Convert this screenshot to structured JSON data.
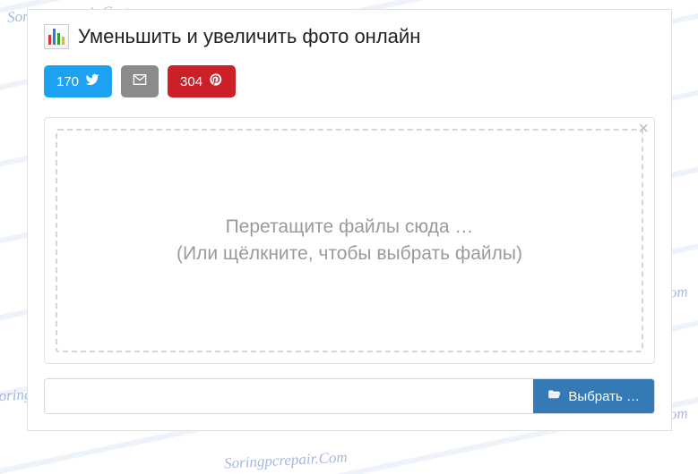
{
  "page": {
    "title": "Уменьшить и увеличить фото онлайн",
    "watermark": "Soringpcrepair.Com"
  },
  "share": {
    "twitter_count": "170",
    "pinterest_count": "304"
  },
  "dropzone": {
    "line1": "Перетащите файлы сюда …",
    "line2": "(Или щёлкните, чтобы выбрать файлы)",
    "close": "×"
  },
  "browse": {
    "label": "Выбрать …",
    "field_value": ""
  },
  "icons": {
    "twitter": "twitter-icon",
    "email": "email-icon",
    "pinterest": "pinterest-icon",
    "folder": "folder-open-icon"
  }
}
